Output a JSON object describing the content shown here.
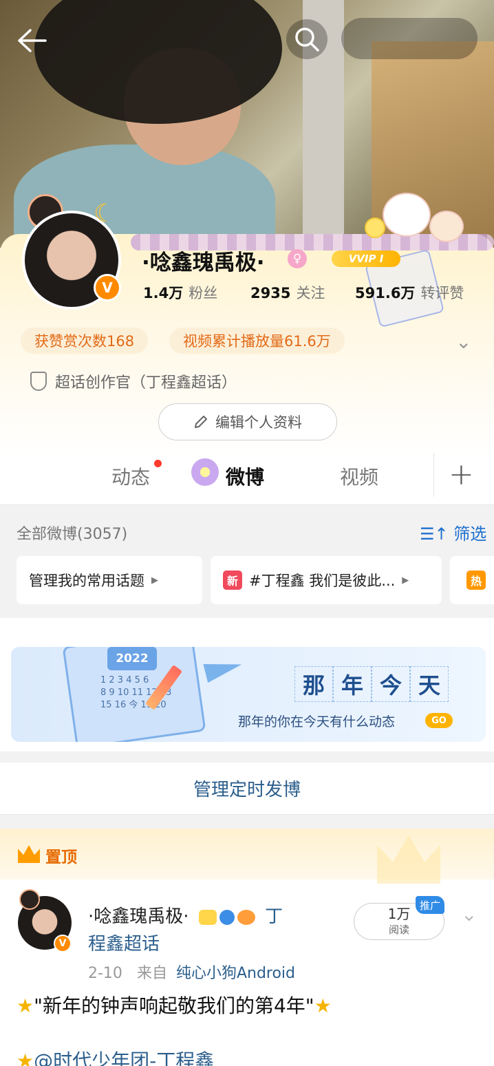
{
  "header": {
    "back_icon": "arrow-left-icon",
    "search_icon": "search-icon"
  },
  "profile": {
    "username": "·唸鑫瑰禹极·",
    "vip_label": "VVIP I",
    "stats": [
      {
        "value": "1.4万",
        "label": "粉丝"
      },
      {
        "value": "2935",
        "label": "关注"
      },
      {
        "value": "591.6万",
        "label": "转评赞"
      }
    ],
    "chips": [
      "获赞赏次数168",
      "视频累计播放量61.6万"
    ],
    "creator_title": "超话创作官（丁程鑫超话）",
    "edit_button": "编辑个人资料",
    "avatar_badge": "V"
  },
  "tabs": [
    {
      "label": "动态",
      "has_dot": true
    },
    {
      "label": "微博",
      "active": true
    },
    {
      "label": "视频"
    }
  ],
  "feed_header": {
    "all_posts": "全部微博(3057)",
    "filter": "筛选"
  },
  "topics": [
    {
      "label": "管理我的常用话题"
    },
    {
      "badge": "新",
      "badge_color": "#f0495c",
      "label": "#丁程鑫 我们是彼此..."
    },
    {
      "badge": "热",
      "badge_color": "#ff9800",
      "label": ""
    }
  ],
  "memory_banner": {
    "calendar_year": "2022",
    "calendar_numbers": "1 2 3 4 5 6\n8 9 10 11 12 13\n15 16 今 19 20",
    "title_chars": [
      "那",
      "年",
      "今",
      "天"
    ],
    "subtitle": "那年的你在今天有什么动态",
    "go": "GO"
  },
  "schedule": "管理定时发博",
  "pinned_post": {
    "pin_label": "置顶",
    "author": "·唸鑫瑰禹极·",
    "topic": "丁程鑫超话",
    "topic_line1": "丁",
    "topic_line2": "程鑫超话",
    "reads_value": "1万",
    "reads_label": "阅读",
    "promo": "推广",
    "date": "2-10",
    "from_label": "来自",
    "source": "纯心小狗Android",
    "text": "\"新年的钟声响起敬我们的第4年\"",
    "mention": "@时代少年团-丁程鑫"
  },
  "colors": {
    "accent_blue": "#1e6fd0",
    "link": "#2b5e8c",
    "chip_text": "#e26a16",
    "pin_orange": "#e66a00"
  }
}
